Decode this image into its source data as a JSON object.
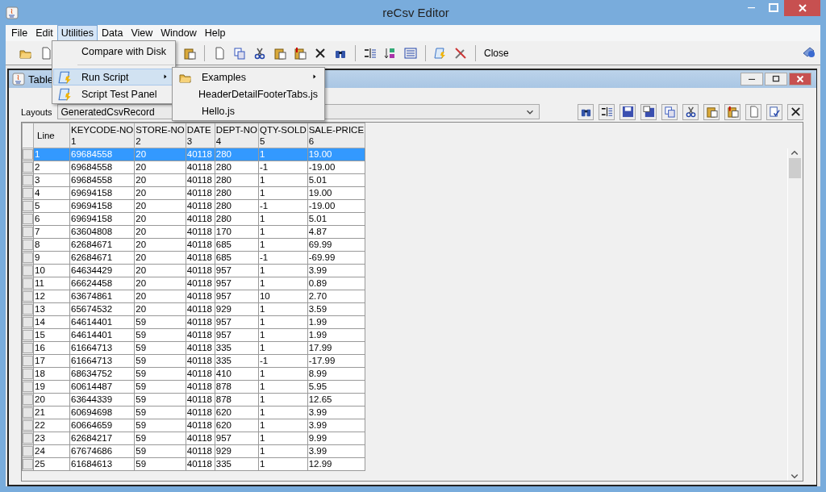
{
  "window": {
    "title": "reCsv Editor"
  },
  "menu_bar": [
    {
      "label": "File",
      "selected": false
    },
    {
      "label": "Edit",
      "selected": false
    },
    {
      "label": "Utilities",
      "selected": true
    },
    {
      "label": "Data",
      "selected": false
    },
    {
      "label": "View",
      "selected": false
    },
    {
      "label": "Window",
      "selected": false
    },
    {
      "label": "Help",
      "selected": false
    }
  ],
  "toolbar": {
    "close_label": "Close"
  },
  "utilities_menu": [
    {
      "label": "Compare with Disk",
      "kind": "plain",
      "selected": false
    },
    {
      "kind": "separator"
    },
    {
      "label": "Run Script",
      "kind": "script",
      "selected": true,
      "submenu": true
    },
    {
      "label": "Script Test Panel",
      "kind": "script",
      "selected": false,
      "submenu": false
    }
  ],
  "run_script_submenu": [
    {
      "label": "Examples",
      "kind": "folder"
    },
    {
      "label": "HeaderDetailFooterTabs.js",
      "kind": "file"
    },
    {
      "label": "Hello.js",
      "kind": "file"
    }
  ],
  "frame": {
    "title": "Table",
    "layouts_label": "Layouts",
    "layout_value": "GeneratedCsvRecord"
  },
  "table": {
    "columns": [
      {
        "name": "Line"
      },
      {
        "name": "KEYCODE-NO",
        "number": "1"
      },
      {
        "name": "STORE-NO",
        "number": "2"
      },
      {
        "name": "DATE",
        "number": "3"
      },
      {
        "name": "DEPT-NO",
        "number": "4"
      },
      {
        "name": "QTY-SOLD",
        "number": "5"
      },
      {
        "name": "SALE-PRICE",
        "number": "6"
      }
    ],
    "rows": [
      {
        "selected": true,
        "cells": [
          "1",
          "69684558",
          "20",
          "40118",
          "280",
          "1",
          "19.00"
        ]
      },
      {
        "selected": false,
        "cells": [
          "2",
          "69684558",
          "20",
          "40118",
          "280",
          "-1",
          "-19.00"
        ]
      },
      {
        "selected": false,
        "cells": [
          "3",
          "69684558",
          "20",
          "40118",
          "280",
          "1",
          "5.01"
        ]
      },
      {
        "selected": false,
        "cells": [
          "4",
          "69694158",
          "20",
          "40118",
          "280",
          "1",
          "19.00"
        ]
      },
      {
        "selected": false,
        "cells": [
          "5",
          "69694158",
          "20",
          "40118",
          "280",
          "-1",
          "-19.00"
        ]
      },
      {
        "selected": false,
        "cells": [
          "6",
          "69694158",
          "20",
          "40118",
          "280",
          "1",
          "5.01"
        ]
      },
      {
        "selected": false,
        "cells": [
          "7",
          "63604808",
          "20",
          "40118",
          "170",
          "1",
          "4.87"
        ]
      },
      {
        "selected": false,
        "cells": [
          "8",
          "62684671",
          "20",
          "40118",
          "685",
          "1",
          "69.99"
        ]
      },
      {
        "selected": false,
        "cells": [
          "9",
          "62684671",
          "20",
          "40118",
          "685",
          "-1",
          "-69.99"
        ]
      },
      {
        "selected": false,
        "cells": [
          "10",
          "64634429",
          "20",
          "40118",
          "957",
          "1",
          "3.99"
        ]
      },
      {
        "selected": false,
        "cells": [
          "11",
          "66624458",
          "20",
          "40118",
          "957",
          "1",
          "0.89"
        ]
      },
      {
        "selected": false,
        "cells": [
          "12",
          "63674861",
          "20",
          "40118",
          "957",
          "10",
          "2.70"
        ]
      },
      {
        "selected": false,
        "cells": [
          "13",
          "65674532",
          "20",
          "40118",
          "929",
          "1",
          "3.59"
        ]
      },
      {
        "selected": false,
        "cells": [
          "14",
          "64614401",
          "59",
          "40118",
          "957",
          "1",
          "1.99"
        ]
      },
      {
        "selected": false,
        "cells": [
          "15",
          "64614401",
          "59",
          "40118",
          "957",
          "1",
          "1.99"
        ]
      },
      {
        "selected": false,
        "cells": [
          "16",
          "61664713",
          "59",
          "40118",
          "335",
          "1",
          "17.99"
        ]
      },
      {
        "selected": false,
        "cells": [
          "17",
          "61664713",
          "59",
          "40118",
          "335",
          "-1",
          "-17.99"
        ]
      },
      {
        "selected": false,
        "cells": [
          "18",
          "68634752",
          "59",
          "40118",
          "410",
          "1",
          "8.99"
        ]
      },
      {
        "selected": false,
        "cells": [
          "19",
          "60614487",
          "59",
          "40118",
          "878",
          "1",
          "5.95"
        ]
      },
      {
        "selected": false,
        "cells": [
          "20",
          "63644339",
          "59",
          "40118",
          "878",
          "1",
          "12.65"
        ]
      },
      {
        "selected": false,
        "cells": [
          "21",
          "60694698",
          "59",
          "40118",
          "620",
          "1",
          "3.99"
        ]
      },
      {
        "selected": false,
        "cells": [
          "22",
          "60664659",
          "59",
          "40118",
          "620",
          "1",
          "3.99"
        ]
      },
      {
        "selected": false,
        "cells": [
          "23",
          "62684217",
          "59",
          "40118",
          "957",
          "1",
          "9.99"
        ]
      },
      {
        "selected": false,
        "cells": [
          "24",
          "67674686",
          "59",
          "40118",
          "929",
          "1",
          "3.99"
        ]
      },
      {
        "selected": false,
        "cells": [
          "25",
          "61684613",
          "59",
          "40118",
          "335",
          "1",
          "12.99"
        ]
      }
    ]
  }
}
